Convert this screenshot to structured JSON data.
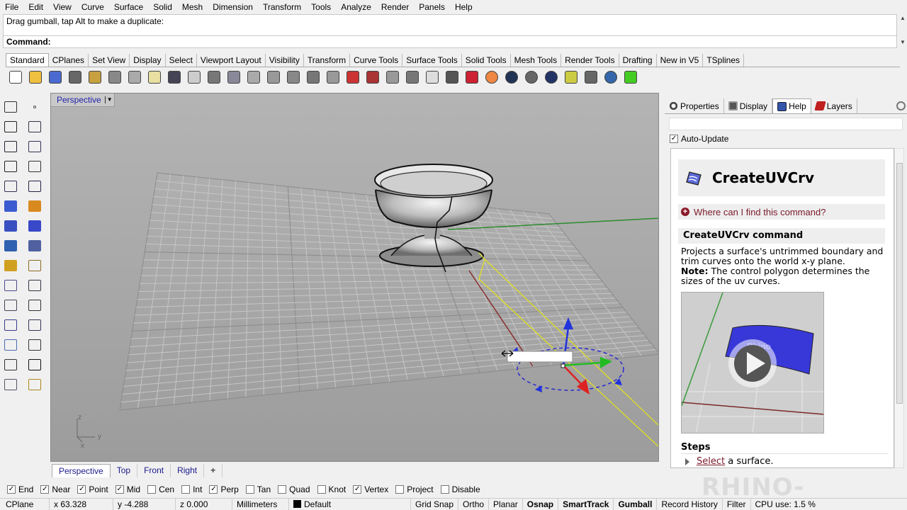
{
  "menu": [
    "File",
    "Edit",
    "View",
    "Curve",
    "Surface",
    "Solid",
    "Mesh",
    "Dimension",
    "Transform",
    "Tools",
    "Analyze",
    "Render",
    "Panels",
    "Help"
  ],
  "history_text": "Drag gumball, tap Alt to make a duplicate:",
  "command_label": "Command:",
  "toolbar_tabs": [
    "Standard",
    "CPlanes",
    "Set View",
    "Display",
    "Select",
    "Viewport Layout",
    "Visibility",
    "Transform",
    "Curve Tools",
    "Surface Tools",
    "Solid Tools",
    "Mesh Tools",
    "Render Tools",
    "Drafting",
    "New in V5",
    "TSplines"
  ],
  "toolbar_icons": [
    "new-file-icon",
    "open-file-icon",
    "save-icon",
    "print-icon",
    "import-icon",
    "cut-icon",
    "copy-icon",
    "paste-icon",
    "undo-icon",
    "pan-icon",
    "rotate-view-icon",
    "zoom-icon",
    "zoom-window-icon",
    "zoom-extents-icon",
    "zoom-selected-icon",
    "rotate-icon",
    "four-views-icon",
    "car-icon",
    "mesh-icon",
    "circle-snap-icon",
    "grid-icon",
    "bulb-icon",
    "lock-icon",
    "layer-icon",
    "color-wheel-icon",
    "sphere-shaded-icon",
    "sphere-rendered-icon",
    "sphere-blue-icon",
    "light-icon",
    "options-icon",
    "help-icon",
    "plugin-icon"
  ],
  "viewport": {
    "title": "Perspective",
    "axis_z": "z",
    "axis_y": "y",
    "axis_x": "x"
  },
  "viewport_tabs": [
    "Perspective",
    "Top",
    "Front",
    "Right",
    "+"
  ],
  "right_panel": {
    "tabs": [
      "Properties",
      "Display",
      "Help",
      "Layers"
    ],
    "auto_update": "Auto-Update",
    "doc_title": "CreateUVCrv",
    "where_link": "Where can I find this command?",
    "command_heading": "CreateUVCrv command",
    "desc": "Projects a surface's untrimmed boundary and trim curves onto the world x-y plane.",
    "note_label": "Note:",
    "note_text": " The control polygon determines the sizes of the uv curves.",
    "steps_heading": "Steps",
    "step_link": "Select",
    "step_text": " a surface."
  },
  "osnaps": [
    {
      "label": "End",
      "checked": true
    },
    {
      "label": "Near",
      "checked": true
    },
    {
      "label": "Point",
      "checked": true
    },
    {
      "label": "Mid",
      "checked": true
    },
    {
      "label": "Cen",
      "checked": false
    },
    {
      "label": "Int",
      "checked": false
    },
    {
      "label": "Perp",
      "checked": true
    },
    {
      "label": "Tan",
      "checked": false
    },
    {
      "label": "Quad",
      "checked": false
    },
    {
      "label": "Knot",
      "checked": false
    },
    {
      "label": "Vertex",
      "checked": true
    },
    {
      "label": "Project",
      "checked": false
    },
    {
      "label": "Disable",
      "checked": false
    }
  ],
  "status": {
    "cplane": "CPlane",
    "x": "x 63.328",
    "y": "y -4.288",
    "z": "z 0.000",
    "units": "Millimeters",
    "layer": "Default",
    "grid_snap": "Grid Snap",
    "ortho": "Ortho",
    "planar": "Planar",
    "osnap": "Osnap",
    "smarttrack": "SmartTrack",
    "gumball": "Gumball",
    "record_history": "Record History",
    "filter": "Filter",
    "cpu": "CPU use: 1.5 %"
  },
  "watermark": "RHINO-HELP.COM"
}
